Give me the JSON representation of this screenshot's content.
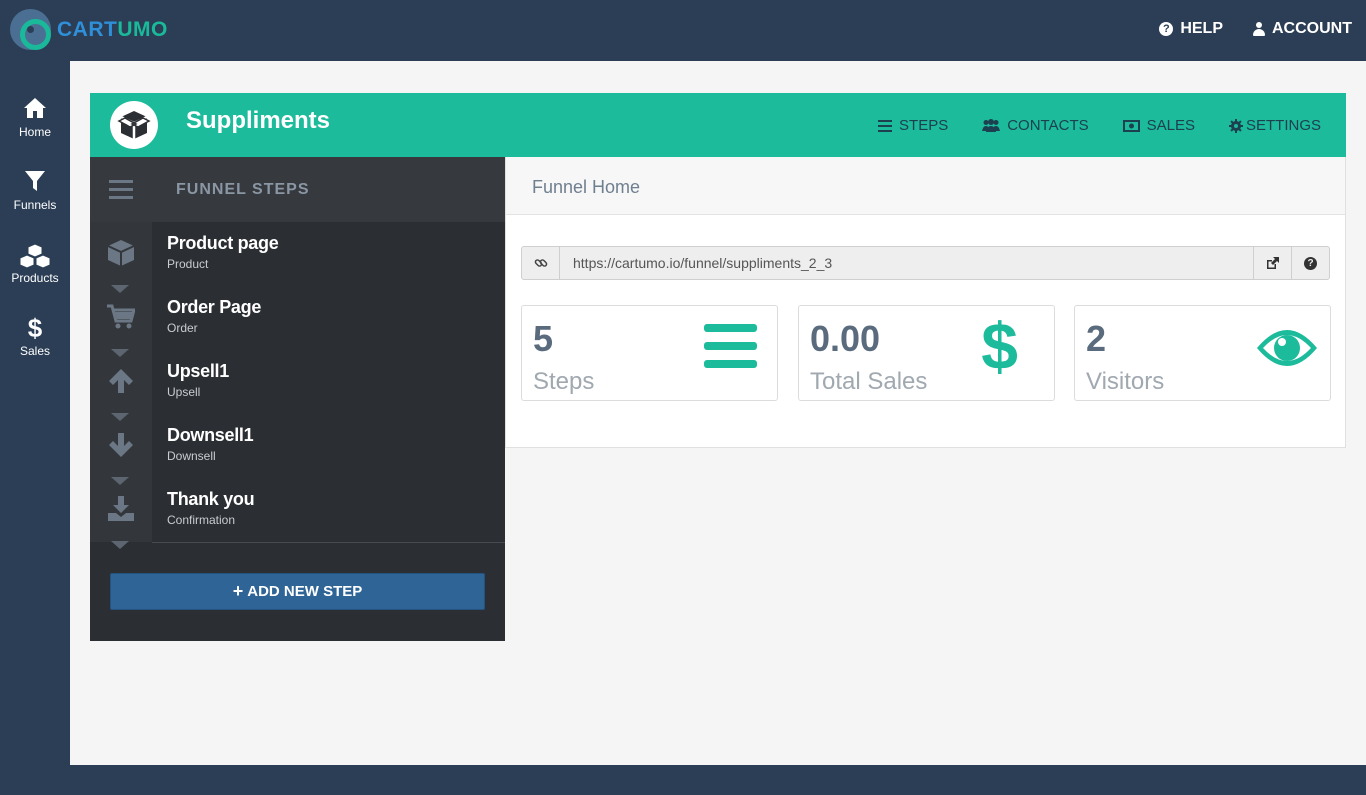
{
  "brand": {
    "part1": "CART",
    "part2": "UMO"
  },
  "topnav": {
    "help": "HELP",
    "account": "ACCOUNT"
  },
  "leftnav": [
    {
      "label": "Home",
      "icon": "home-icon"
    },
    {
      "label": "Funnels",
      "icon": "filter-icon"
    },
    {
      "label": "Products",
      "icon": "cubes-icon"
    },
    {
      "label": "Sales",
      "icon": "dollar-icon"
    }
  ],
  "funnel": {
    "title": "Suppliments",
    "nav": {
      "steps": "STEPS",
      "contacts": "CONTACTS",
      "sales": "SALES",
      "settings": "SETTINGS"
    }
  },
  "steps_panel": {
    "title": "FUNNEL STEPS",
    "steps": [
      {
        "name": "Product page",
        "type": "Product",
        "icon": "cube-icon"
      },
      {
        "name": "Order Page",
        "type": "Order",
        "icon": "cart-icon"
      },
      {
        "name": "Upsell1",
        "type": "Upsell",
        "icon": "arrow-up-icon"
      },
      {
        "name": "Downsell1",
        "type": "Downsell",
        "icon": "arrow-down-icon"
      },
      {
        "name": "Thank you",
        "type": "Confirmation",
        "icon": "download-icon"
      }
    ],
    "add_button": "ADD NEW STEP"
  },
  "home": {
    "title": "Funnel Home",
    "url": "https://cartumo.io/funnel/suppliments_2_3",
    "stats": [
      {
        "value": "5",
        "label": "Steps",
        "icon": "bars-icon"
      },
      {
        "value": "0.00",
        "label": "Total Sales",
        "icon": "dollar-icon"
      },
      {
        "value": "2",
        "label": "Visitors",
        "icon": "eye-icon"
      }
    ]
  },
  "colors": {
    "navbar": "#2b3e55",
    "accent": "#1cbb9b",
    "steps_bg": "#2b2e33",
    "add_button": "#2f6496"
  }
}
